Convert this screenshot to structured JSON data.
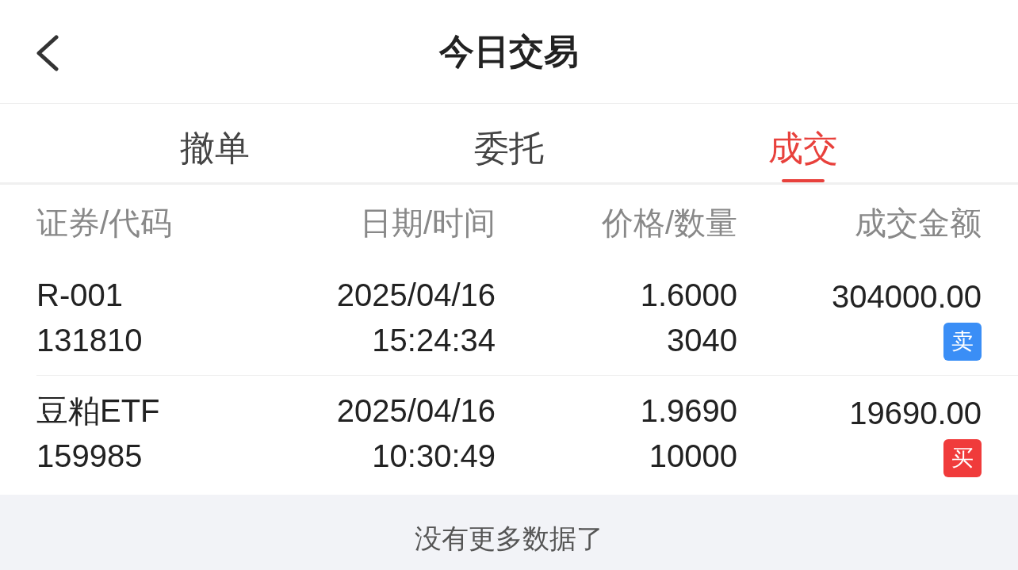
{
  "header": {
    "title": "今日交易"
  },
  "tabs": [
    {
      "label": "撤单",
      "selected": false
    },
    {
      "label": "委托",
      "selected": false
    },
    {
      "label": "成交",
      "selected": true
    }
  ],
  "table": {
    "columns": [
      "证券/代码",
      "日期/时间",
      "价格/数量",
      "成交金额"
    ],
    "rows": [
      {
        "name": "R-001",
        "code": "131810",
        "date": "2025/04/16",
        "time": "15:24:34",
        "price": "1.6000",
        "quantity": "3040",
        "amount": "304000.00",
        "side": "卖",
        "color": "#3a8ef6"
      },
      {
        "name": "豆粕ETF",
        "code": "159985",
        "date": "2025/04/16",
        "time": "10:30:49",
        "price": "1.9690",
        "quantity": "10000",
        "amount": "19690.00",
        "side": "买",
        "color": "#f03b3b"
      }
    ]
  },
  "footer": {
    "text": "没有更多数据了"
  }
}
